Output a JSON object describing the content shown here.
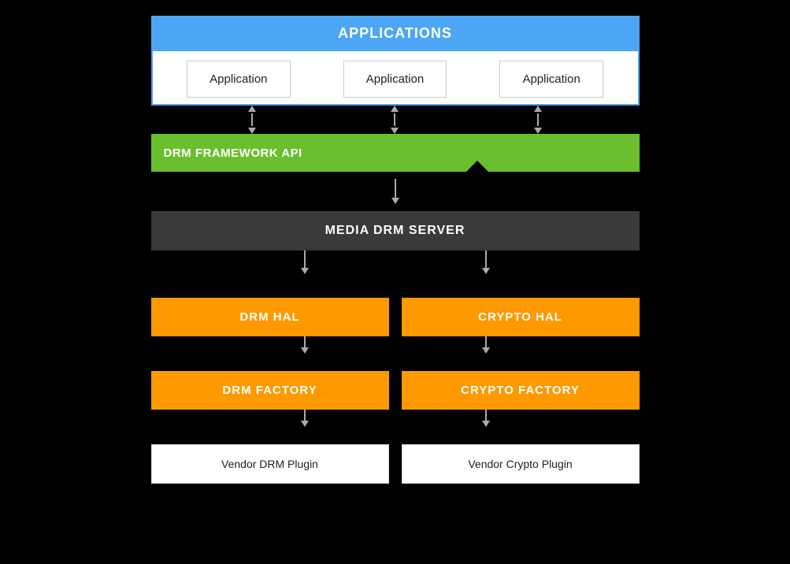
{
  "applications": {
    "header": "APPLICATIONS",
    "app1": "Application",
    "app2": "Application",
    "app3": "Application"
  },
  "drmFramework": {
    "label": "DRM FRAMEWORK API"
  },
  "mediaDrm": {
    "label": "MEDIA DRM SERVER"
  },
  "hal": {
    "drm": "DRM HAL",
    "crypto": "CRYPTO HAL"
  },
  "factory": {
    "drm": "DRM FACTORY",
    "crypto": "CRYPTO FACTORY"
  },
  "plugins": {
    "drm": "Vendor DRM Plugin",
    "crypto": "Vendor Crypto Plugin"
  },
  "colors": {
    "blue": "#4da6f5",
    "green": "#6abf2e",
    "orange": "#ff9900",
    "darkGray": "#3a3a3a",
    "arrow": "#aaa"
  }
}
